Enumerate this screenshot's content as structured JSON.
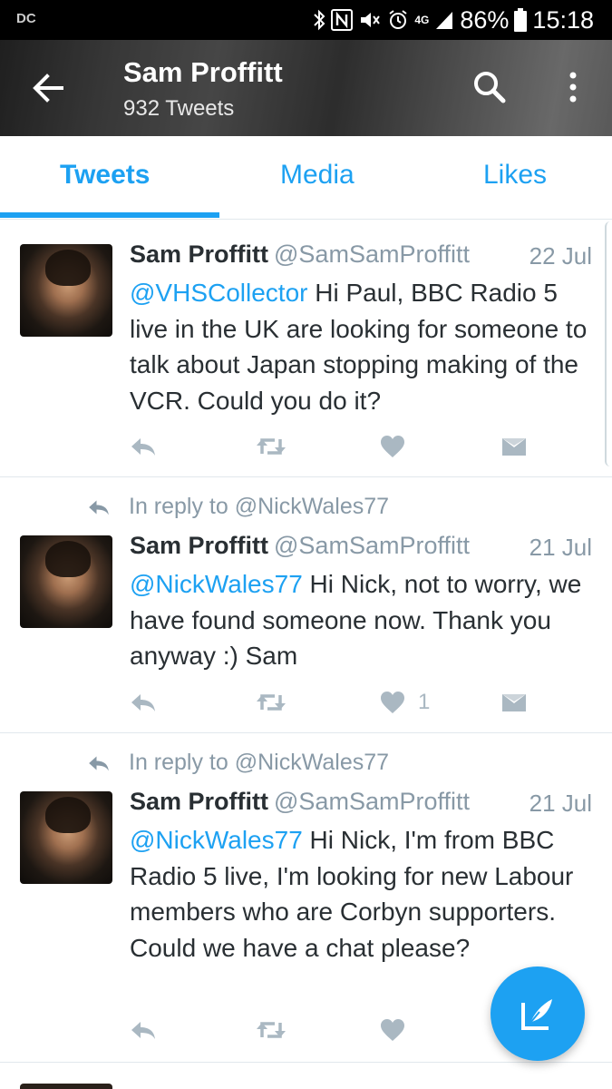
{
  "status_bar": {
    "carrier": "DC",
    "network": "4G",
    "battery": "86%",
    "time": "15:18"
  },
  "header": {
    "title": "Sam Proffitt",
    "subtitle": "932 Tweets"
  },
  "tabs": [
    {
      "label": "Tweets",
      "active": true
    },
    {
      "label": "Media",
      "active": false
    },
    {
      "label": "Likes",
      "active": false
    }
  ],
  "tweets": [
    {
      "name": "Sam Proffitt",
      "handle": "@SamSamProffitt",
      "date": "22 Jul",
      "mention": "@VHSCollector",
      "text": " Hi Paul, BBC Radio 5 live in the UK are looking for someone to talk about Japan stopping making of the VCR. Could you do it?",
      "like_count": ""
    },
    {
      "reply_to": "In reply to @NickWales77",
      "name": "Sam Proffitt",
      "handle": "@SamSamProffitt",
      "date": "21 Jul",
      "mention": "@NickWales77",
      "text": " Hi Nick, not to worry, we have found someone now. Thank you anyway :) Sam",
      "like_count": "1"
    },
    {
      "reply_to": "In reply to @NickWales77",
      "name": "Sam Proffitt",
      "handle": "@SamSamProffitt",
      "date": "21 Jul",
      "mention": "@NickWales77",
      "text": " Hi Nick, I'm from BBC Radio 5 live, I'm looking for new Labour members who are Corbyn supporters. Could we have a chat please?",
      "like_count": ""
    }
  ],
  "colors": {
    "accent": "#1da1f2",
    "muted": "#8899a6",
    "action": "#aab8c2"
  }
}
